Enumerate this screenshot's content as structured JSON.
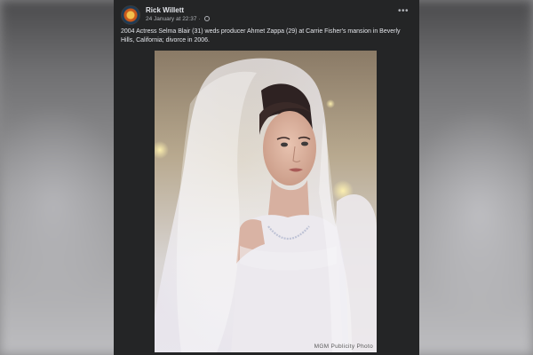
{
  "post": {
    "author": "Rick Willett",
    "timestamp": "24 January at 22:37",
    "privacy_icon": "globe-icon",
    "more_icon": "more-horizontal-icon",
    "more_label": "•••",
    "text": "2004 Actress Selma Blair (31) weds producer Ahmet Zappa (29) at Carrie Fisher's mansion in Beverly Hills, California; divorce in 2006.",
    "photo_credit": "MGM Publicity Photo"
  },
  "colors": {
    "card_background": "#242526",
    "primary_text": "#e4e6eb",
    "secondary_text": "#b0b3b8"
  }
}
